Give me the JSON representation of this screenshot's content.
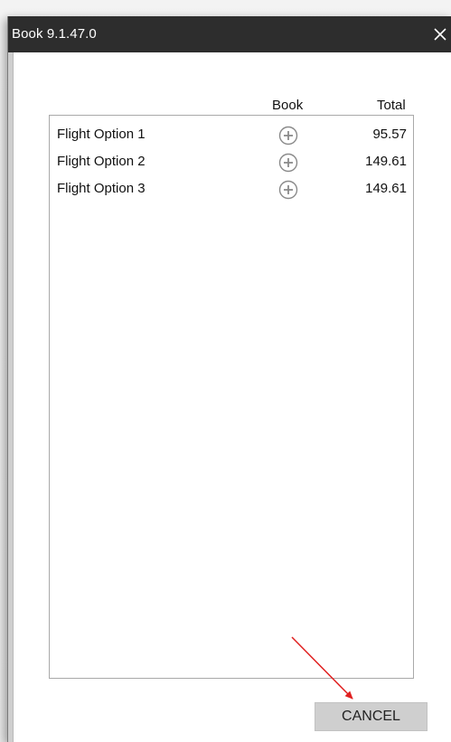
{
  "window": {
    "title": "Book  9.1.47.0",
    "close_glyph": "X"
  },
  "table": {
    "columns": {
      "book": "Book",
      "total": "Total"
    },
    "rows": [
      {
        "name": "Flight Option 1",
        "total": "95.57",
        "book_icon": "plus-circle-icon"
      },
      {
        "name": "Flight Option 2",
        "total": "149.61",
        "book_icon": "plus-circle-icon"
      },
      {
        "name": "Flight Option 3",
        "total": "149.61",
        "book_icon": "plus-circle-icon"
      }
    ]
  },
  "footer": {
    "cancel_label": "CANCEL"
  },
  "colors": {
    "titlebar_bg": "#2d2d2d",
    "button_bg": "#cfcfcf",
    "annotation_arrow": "#e02020"
  }
}
